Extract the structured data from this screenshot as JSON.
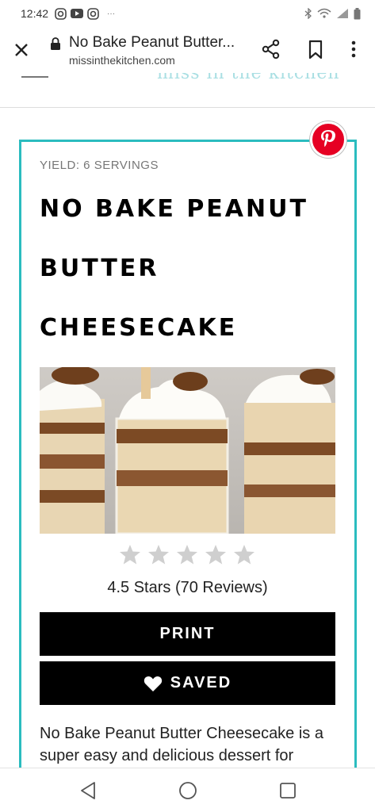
{
  "status_bar": {
    "time": "12:42",
    "icons": [
      "instagram-icon",
      "youtube-icon",
      "instagram-icon",
      "more-notifications-icon"
    ],
    "right_icons": [
      "bluetooth-icon",
      "wifi-icon",
      "signal-icon",
      "battery-icon"
    ]
  },
  "browser": {
    "title": "No Bake Peanut Butter...",
    "url": "missinthekitchen.com"
  },
  "site": {
    "logo_text": "miss in the kitchen"
  },
  "recipe": {
    "yield": "YIELD: 6 SERVINGS",
    "title_lines": [
      "NO BAKE PEANUT",
      "BUTTER",
      "CHEESECAKE"
    ],
    "rating_text": "4.5 Stars (70 Reviews)",
    "star_count": 5,
    "print_label": "PRINT",
    "saved_label": "SAVED",
    "description": "No Bake Peanut Butter Cheesecake is a super easy and delicious dessert for"
  },
  "colors": {
    "accent": "#2bbcbf",
    "pinterest": "#e60023",
    "button_bg": "#000000",
    "star": "#cfcfcf"
  }
}
